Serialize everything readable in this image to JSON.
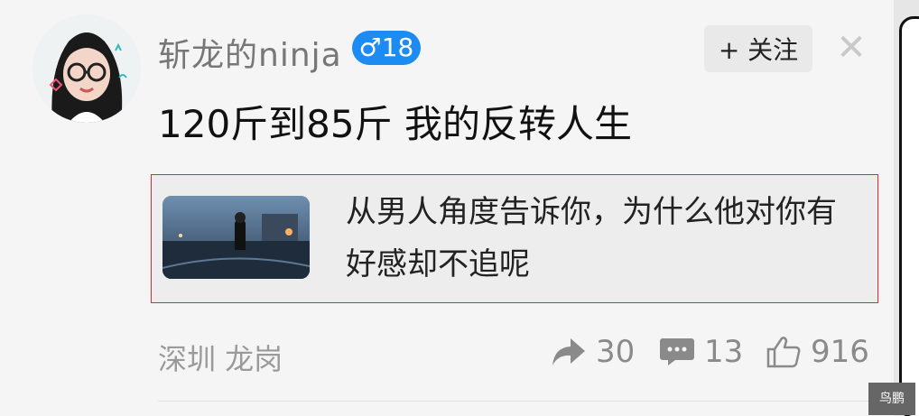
{
  "post": {
    "username": "斩龙的ninja",
    "gender_badge": "♂18",
    "follow_label": "+ 关注",
    "close_label": "✕",
    "title": "120斤到85斤 我的反转人生",
    "card": {
      "text": "从男人角度告诉你，为什么他对你有好感却不追呢"
    },
    "location": "深圳 龙岗",
    "stats": {
      "shares": "30",
      "comments": "13",
      "likes": "916"
    }
  },
  "watermark": "鸟鹏",
  "icons": {
    "share": "share-arrow-icon",
    "comment": "comment-bubble-icon",
    "like": "thumbs-up-icon",
    "close": "close-icon",
    "plus": "plus-icon"
  },
  "colors": {
    "badge_blue": "#1d8cf2",
    "highlight_border": "#ee2233"
  }
}
